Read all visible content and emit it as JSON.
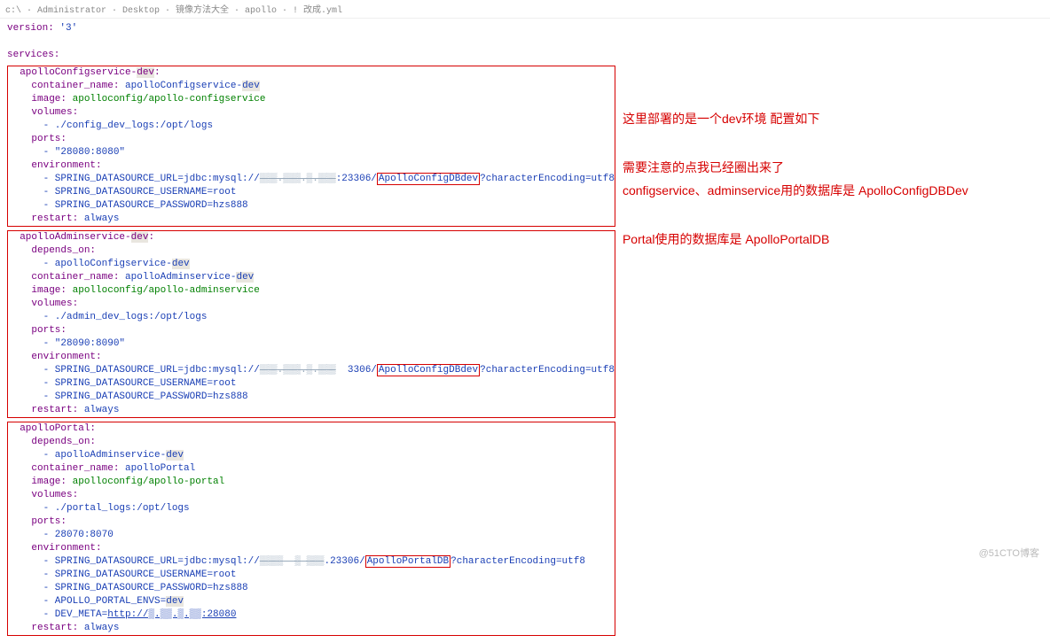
{
  "breadcrumb": "c:\\  · Administrator  ·  Desktop  ·  镜像方法大全  ·  apollo  ·  !  改成.yml",
  "watermark": "@51CTO博客",
  "notes": {
    "p1": "这里部署的是一个dev环境 配置如下",
    "p2a": "需要注意的点我已经圈出来了",
    "p2b": "configservice、adminservice用的数据库是 ApolloConfigDBDev",
    "p3": "Portal使用的数据库是 ApolloPortalDB"
  },
  "yaml": {
    "version_key": "version:",
    "version_val": "'3'",
    "services_key": "services:",
    "svc1": {
      "name": "apolloConfigservice-",
      "suffix": "dev",
      "container_name_k": "container_name:",
      "container_name_v": "apolloConfigservice-",
      "image_k": "image:",
      "image_v": "apolloconfig/apollo-configservice",
      "volumes_k": "volumes:",
      "volumes_v": "- ./config_dev_logs:/opt/logs",
      "ports_k": "ports:",
      "ports_v": "- \"28080:8080\"",
      "env_k": "environment:",
      "env_url_pref": "- SPRING_DATASOURCE_URL=jdbc:mysql://",
      "env_url_host": "▒▒▒.▒▒▒.▒.▒▒▒",
      "env_url_port": ":23306/",
      "env_url_db": "ApolloConfigDBdev",
      "env_url_tail": "?characterEncoding=utf8",
      "env_user": "- SPRING_DATASOURCE_USERNAME=root",
      "env_pass": "- SPRING_DATASOURCE_PASSWORD=hzs888",
      "restart_k": "restart:",
      "restart_v": "always"
    },
    "svc2": {
      "name": "apolloAdminservice-",
      "suffix": "dev",
      "depends_k": "depends_on:",
      "depends_v": "- apolloConfigservice-",
      "container_name_k": "container_name:",
      "container_name_v": "apolloAdminservice-",
      "image_k": "image:",
      "image_v": "apolloconfig/apollo-adminservice",
      "volumes_k": "volumes:",
      "volumes_v": "- ./admin_dev_logs:/opt/logs",
      "ports_k": "ports:",
      "ports_v": "- \"28090:8090\"",
      "env_k": "environment:",
      "env_url_pref": "- SPRING_DATASOURCE_URL=jdbc:mysql://",
      "env_url_host": "▒▒▒.▒▒▒.▒.▒▒▒",
      "env_url_port": "  3306/",
      "env_url_db": "ApolloConfigDBdev",
      "env_url_tail": "?characterEncoding=utf8",
      "env_user": "- SPRING_DATASOURCE_USERNAME=root",
      "env_pass": "- SPRING_DATASOURCE_PASSWORD=hzs888",
      "restart_k": "restart:",
      "restart_v": "always"
    },
    "svc3": {
      "name": "apolloPortal",
      "depends_k": "depends_on:",
      "depends_v": "- apolloAdminservice-",
      "depends_suffix": "dev",
      "container_name_k": "container_name:",
      "container_name_v": "apolloPortal",
      "image_k": "image:",
      "image_v": "apolloconfig/apollo-portal",
      "volumes_k": "volumes:",
      "volumes_v": "- ./portal_logs:/opt/logs",
      "ports_k": "ports:",
      "ports_v": "- 28070:8070",
      "env_k": "environment:",
      "env_url_pref": "- SPRING_DATASOURCE_URL=jdbc:mysql://",
      "env_url_host": "▒▒▒▒  ▒ ▒▒▒",
      "env_url_port": ".23306/",
      "env_url_db": "ApolloPortalDB",
      "env_url_tail": "?characterEncoding=utf8",
      "env_user": "- SPRING_DATASOURCE_USERNAME=root",
      "env_pass": "- SPRING_DATASOURCE_PASSWORD=hzs888",
      "env_envs": "- APOLLO_PORTAL_ENVS=",
      "env_envs_v": "dev",
      "env_meta_k": "- DEV_META=",
      "env_meta_v": "http://▒.▒▒.▒.▒▒:28080",
      "restart_k": "restart:",
      "restart_v": "always"
    }
  }
}
